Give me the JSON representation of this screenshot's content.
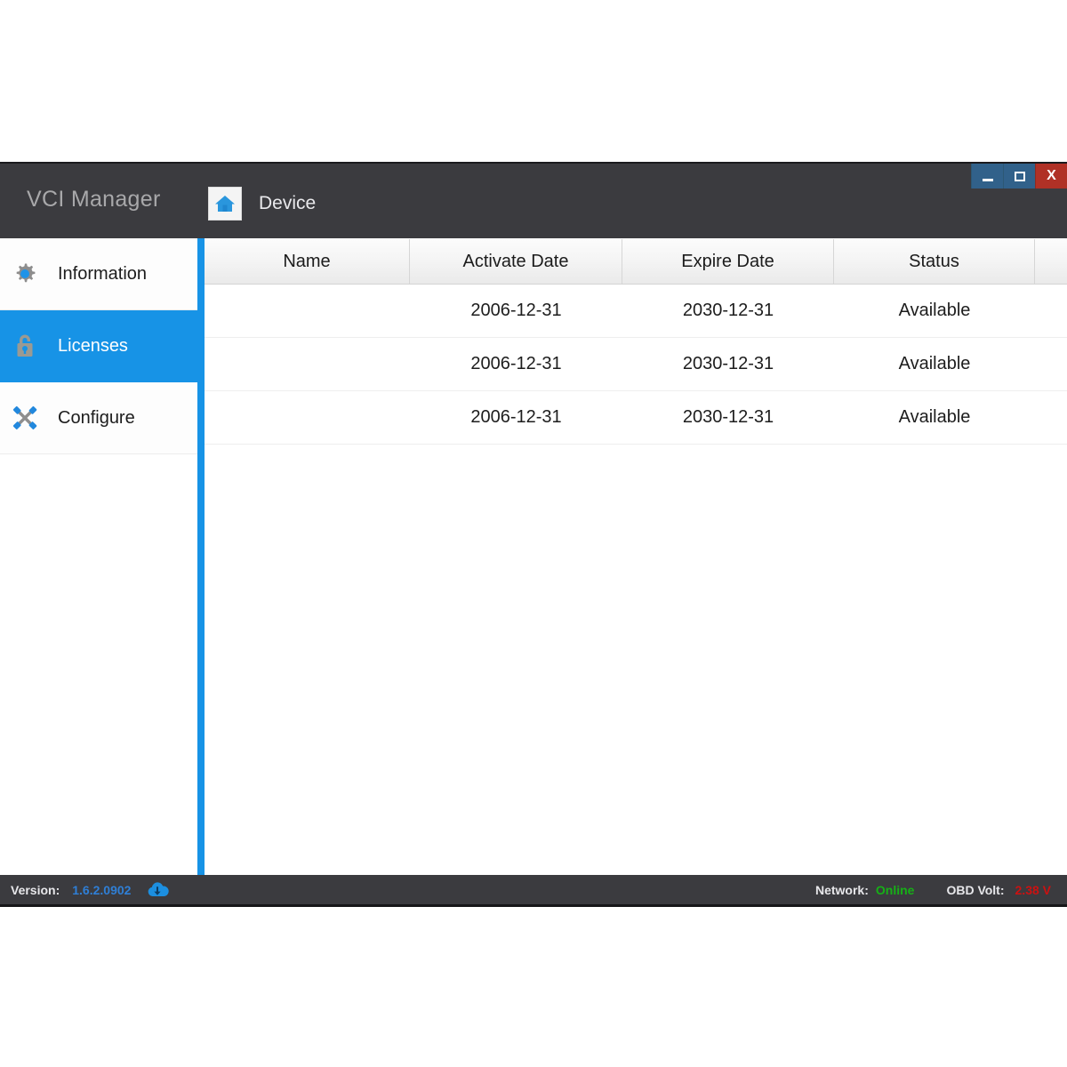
{
  "window": {
    "title": "VCI Manager",
    "controls": {
      "minimize": "minimize-button",
      "maximize": "maximize-button",
      "close": "X"
    }
  },
  "toolbar": {
    "device_label": "Device",
    "home_icon": "home-icon"
  },
  "sidebar": {
    "items": [
      {
        "label": "Information",
        "icon": "gear-icon",
        "active": false
      },
      {
        "label": "Licenses",
        "icon": "lock-icon",
        "active": true
      },
      {
        "label": "Configure",
        "icon": "tools-icon",
        "active": false
      }
    ]
  },
  "table": {
    "columns": [
      "Name",
      "Activate Date",
      "Expire Date",
      "Status",
      ""
    ],
    "rows": [
      {
        "name": "",
        "activate_date": "2006-12-31",
        "expire_date": "2030-12-31",
        "status": "Available",
        "extra": ""
      },
      {
        "name": "",
        "activate_date": "2006-12-31",
        "expire_date": "2030-12-31",
        "status": "Available",
        "extra": ""
      },
      {
        "name": "",
        "activate_date": "2006-12-31",
        "expire_date": "2030-12-31",
        "status": "Available",
        "extra": ""
      }
    ]
  },
  "statusbar": {
    "version_label": "Version:",
    "version_value": "1.6.2.0902",
    "update_icon": "cloud-download-icon",
    "network_label": "Network:",
    "network_value": "Online",
    "volt_label": "OBD Volt:",
    "volt_value": "2.38 V"
  },
  "colors": {
    "accent_blue": "#1793e6",
    "titlebar_dark": "#3b3b3f",
    "status_online_green": "#16b016",
    "status_volt_red": "#cc1111",
    "close_red": "#b03126",
    "version_blue": "#2f7fd6"
  }
}
